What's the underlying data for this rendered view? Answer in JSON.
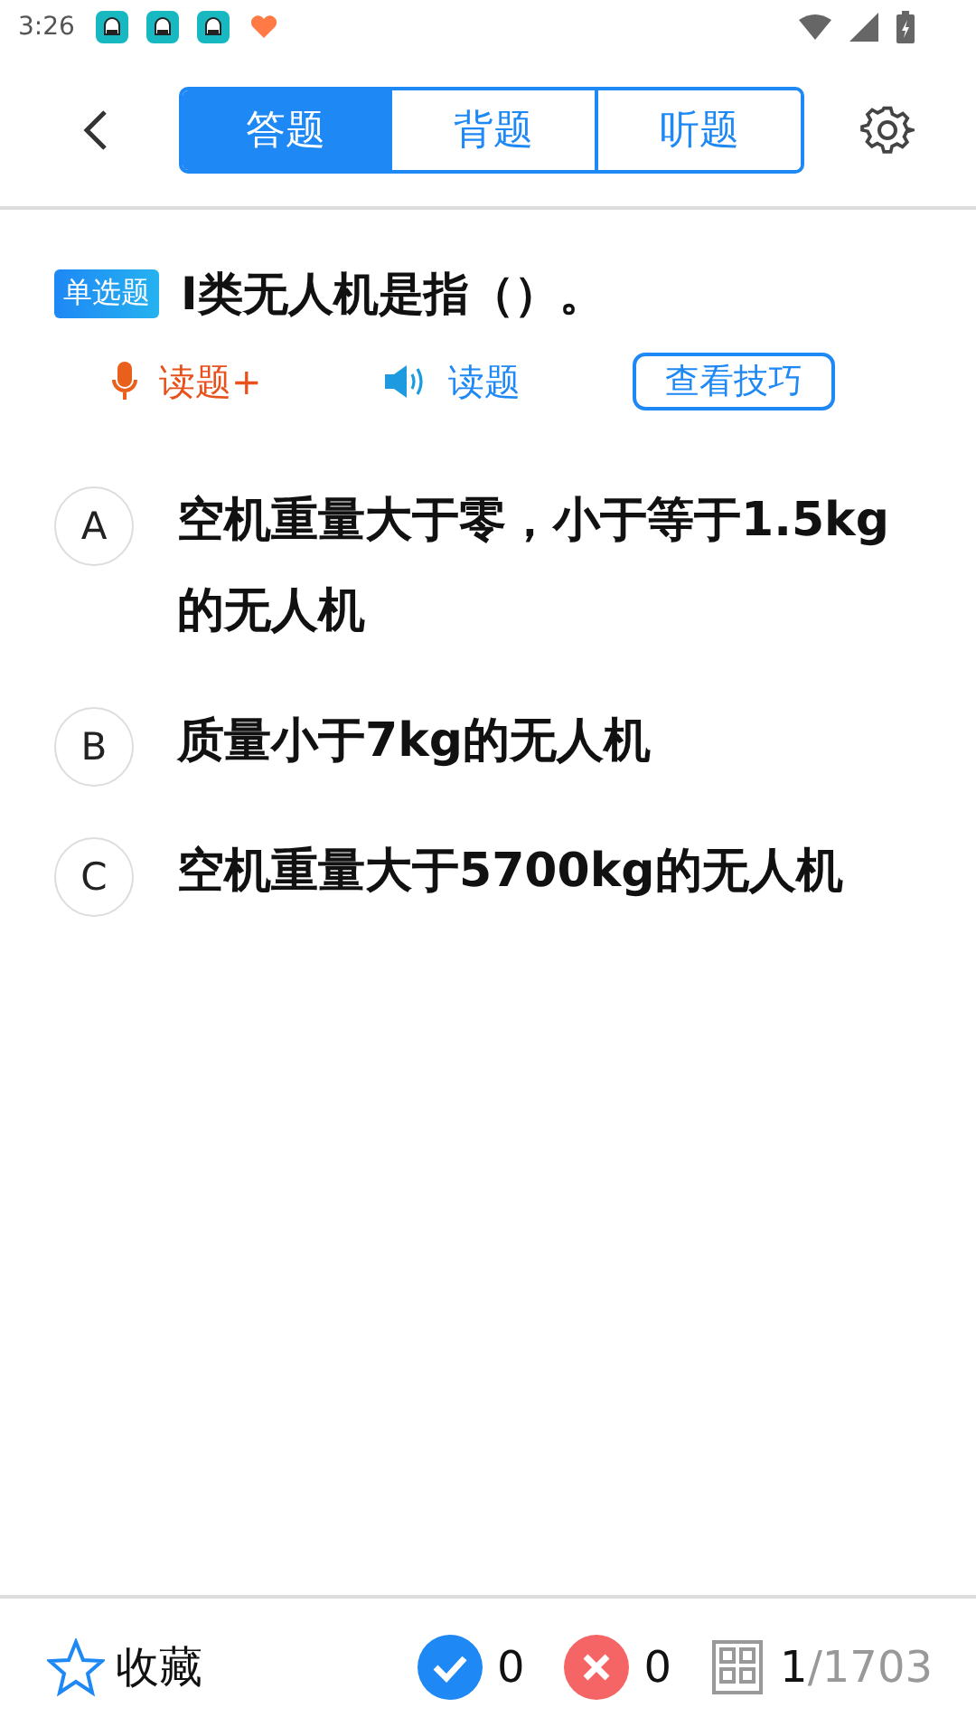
{
  "status_bar": {
    "time": "3:26"
  },
  "tabs": [
    {
      "label": "答题",
      "selected": true
    },
    {
      "label": "背题",
      "selected": false
    },
    {
      "label": "听题",
      "selected": false
    }
  ],
  "question": {
    "badge": "单选题",
    "text": "I类无人机是指（）。"
  },
  "actions": {
    "voice_read": "读题+",
    "read_aloud": "读题",
    "tips": "查看技巧"
  },
  "options": [
    {
      "letter": "A",
      "text": "空机重量大于零，小于等于1.5kg的无人机"
    },
    {
      "letter": "B",
      "text": "质量小于7kg的无人机"
    },
    {
      "letter": "C",
      "text": "空机重量大于5700kg的无人机"
    }
  ],
  "bottom_bar": {
    "favorite": "收藏",
    "correct_count": "0",
    "wrong_count": "0",
    "progress_current": "1",
    "progress_total": "/1703"
  }
}
